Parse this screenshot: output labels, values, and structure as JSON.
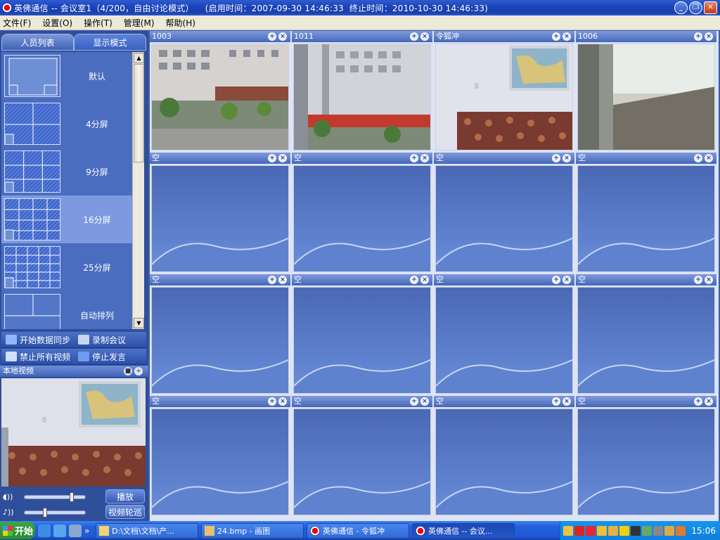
{
  "window": {
    "title": "英佛通信 -- 会议室1（4/200，自由讨论模式）    (启用时间：2007-09-30 14:46:33  终止时间：2010-10-30 14:46:33)",
    "buttons": [
      "_",
      "❐",
      "✕"
    ]
  },
  "menu": [
    {
      "label": "文件(F)"
    },
    {
      "label": "设置(O)"
    },
    {
      "label": "操作(T)"
    },
    {
      "label": "管理(M)"
    },
    {
      "label": "帮助(H)"
    }
  ],
  "left_panel": {
    "tabs": [
      {
        "label": "人员列表",
        "active": false
      },
      {
        "label": "显示模式",
        "active": true
      }
    ],
    "layouts": [
      {
        "label": "默认",
        "selected": false,
        "icon": "default-layout"
      },
      {
        "label": "4分屏",
        "selected": false,
        "icon": "four-split-layout"
      },
      {
        "label": "9分屏",
        "selected": false,
        "icon": "nine-split-layout"
      },
      {
        "label": "16分屏",
        "selected": true,
        "icon": "sixteen-split-layout"
      },
      {
        "label": "25分屏",
        "selected": false,
        "icon": "twentyfive-split-layout"
      },
      {
        "label": "自动排列",
        "selected": false,
        "icon": "auto-arrange-layout"
      }
    ],
    "actions": [
      {
        "label": "开始数据同步",
        "icon": "sync-icon",
        "color": "#8fb7ff"
      },
      {
        "label": "录制会议",
        "icon": "record-icon",
        "color": "#c8d6f3"
      },
      {
        "label": "禁止所有视频",
        "icon": "disable-video-icon",
        "color": "#cfe0ff"
      },
      {
        "label": "停止发言",
        "icon": "stop-speaking-icon",
        "color": "#6f9cf0"
      }
    ],
    "local_video": {
      "title": "本地视频"
    },
    "play_label": "播放",
    "rotate_label": "视频轮巡",
    "volume_level": 0.78,
    "mic_level": 0.32
  },
  "grid": {
    "cells": [
      {
        "label": "1003",
        "type": "street"
      },
      {
        "label": "1011",
        "type": "street2"
      },
      {
        "label": "令狐冲",
        "type": "room"
      },
      {
        "label": "1006",
        "type": "window"
      },
      {
        "label": "空",
        "type": "empty"
      },
      {
        "label": "空",
        "type": "empty"
      },
      {
        "label": "空",
        "type": "empty"
      },
      {
        "label": "空",
        "type": "empty"
      },
      {
        "label": "空",
        "type": "empty"
      },
      {
        "label": "空",
        "type": "empty"
      },
      {
        "label": "空",
        "type": "empty"
      },
      {
        "label": "空",
        "type": "empty"
      },
      {
        "label": "空",
        "type": "empty"
      },
      {
        "label": "空",
        "type": "empty"
      },
      {
        "label": "空",
        "type": "empty"
      },
      {
        "label": "空",
        "type": "empty"
      }
    ]
  },
  "taskbar": {
    "start_label": "开始",
    "tasks": [
      {
        "label": "D:\\文档\\文档\\产...",
        "icon": "folder-icon",
        "active": false
      },
      {
        "label": "24.bmp - 画图",
        "icon": "paint-icon",
        "active": false
      },
      {
        "label": "英佛通信 - 令狐冲",
        "icon": "app-icon",
        "active": false
      },
      {
        "label": "英佛通信 -- 会议...",
        "icon": "app-icon",
        "active": true
      }
    ],
    "clock": "15:06",
    "quicklaunch_more": "»"
  }
}
